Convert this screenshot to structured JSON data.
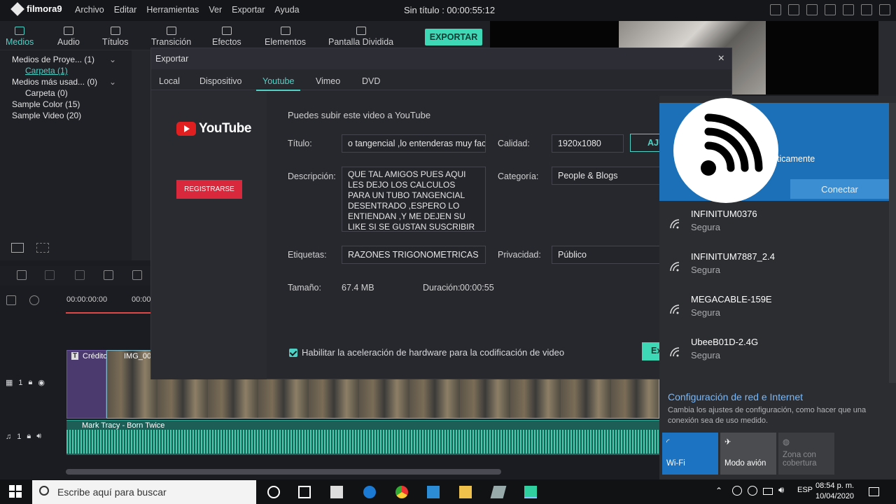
{
  "app": {
    "logo_text": "filmora9",
    "menu": [
      "Archivo",
      "Editar",
      "Herramientas",
      "Ver",
      "Exportar",
      "Ayuda"
    ],
    "title": "Sin título : 00:00:55:12"
  },
  "toolbar": {
    "tabs": [
      "Medios",
      "Audio",
      "Títulos",
      "Transición",
      "Efectos",
      "Elementos",
      "Pantalla Dividida"
    ],
    "export_label": "EXPORTAR"
  },
  "media": {
    "items": [
      "Medios de Proye... (1)",
      "Carpeta (1)",
      "Medios más usad... (0)",
      "Carpeta (0)",
      "Sample Color (15)",
      "Sample Video (20)"
    ]
  },
  "timeline": {
    "timecode_start": "00:00:00:00",
    "timecode_next": "00:00",
    "credit_clip": "Crédito",
    "video_clip": "IMG_00",
    "audio_clip": "Mark Tracy - Born Twice",
    "video_track": "1",
    "audio_track": "1"
  },
  "export_dialog": {
    "title": "Exportar",
    "tabs": [
      "Local",
      "Dispositivo",
      "Youtube",
      "Vimeo",
      "DVD"
    ],
    "active_tab": "Youtube",
    "youtube_label": "YouTube",
    "register_label": "REGISTRARSE",
    "upload_hint": "Puedes subir este video a YouTube",
    "fields": {
      "title_label": "Título:",
      "title_value": "o tangencial ,lo entenderas muy facil",
      "quality_label": "Calidad:",
      "quality_value": "1920x1080",
      "adjust_label": "AJU",
      "description_label": "Descripción:",
      "description_value": "QUE TAL AMIGOS PUES AQUI LES DEJO LOS CALCULOS PARA UN TUBO TANGENCIAL DESENTRADO ,ESPERO LO ENTIENDAN ,Y ME DEJEN SU LIKE SI SE GUSTAN SUSCRIBIR",
      "category_label": "Categoría:",
      "category_value": "People & Blogs",
      "tags_label": "Etiquetas:",
      "tags_value": "RAZONES TRIGONOMETRICAS",
      "privacy_label": "Privacidad:",
      "privacy_value": "Público",
      "size_label": "Tamaño:",
      "size_value": "67.4 MB",
      "duration_label": "Duración:",
      "duration_value": "00:00:55"
    },
    "hw_accel_label": "Habilitar la aceleración de hardware para la codificación de video",
    "hw_accel_checked": true,
    "export_btn": "Ex"
  },
  "wifi": {
    "auto_text": "ticamente",
    "connect_label": "Conectar",
    "networks": [
      {
        "name": "INFINITUM0376",
        "status": "Segura"
      },
      {
        "name": "INFINITUM7887_2.4",
        "status": "Segura"
      },
      {
        "name": "MEGACABLE-159E",
        "status": "Segura"
      },
      {
        "name": "UbeeB01D-2.4G",
        "status": "Segura"
      }
    ],
    "settings_title": "Configuración de red e Internet",
    "settings_desc": "Cambia los ajustes de configuración, como hacer que una conexión sea de uso medido.",
    "tiles": [
      {
        "label": "Wi-Fi",
        "active": true
      },
      {
        "label": "Modo avión",
        "active": false
      },
      {
        "label": "Zona con cobertura",
        "active": false
      }
    ]
  },
  "taskbar": {
    "search_placeholder": "Escribe aquí para buscar",
    "lang": "ESP",
    "time": "08:54 p. m.",
    "date": "10/04/2020"
  },
  "colors": {
    "accent": "#3fd8b6",
    "youtube_red": "#e02020",
    "wifi_blue": "#1c70b8"
  }
}
